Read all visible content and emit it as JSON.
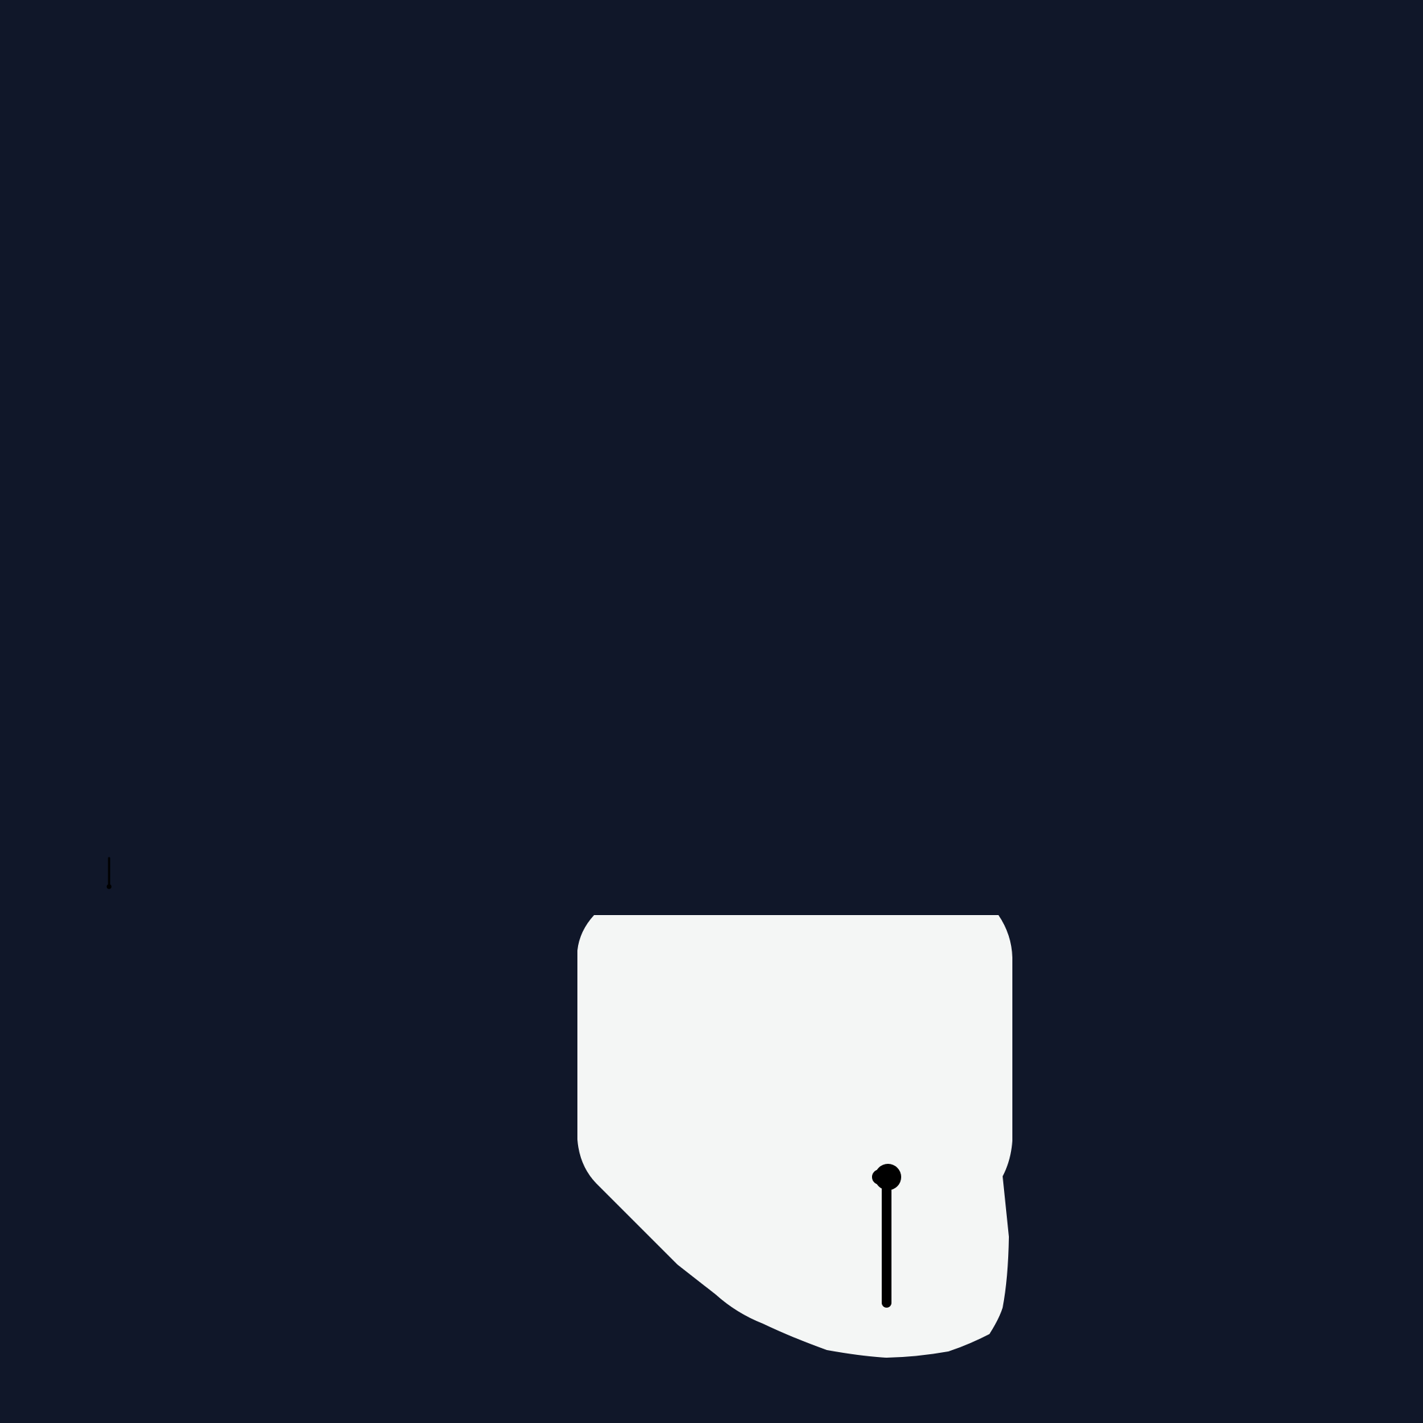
{
  "canvas": {
    "background_color": "#101729"
  },
  "icon": {
    "name": "lightbulb-outline-icon",
    "fill_color": "#F4F6F5",
    "stroke_color": "#000000"
  },
  "marker": {
    "name": "small-pin-marker",
    "color": "#000000"
  }
}
